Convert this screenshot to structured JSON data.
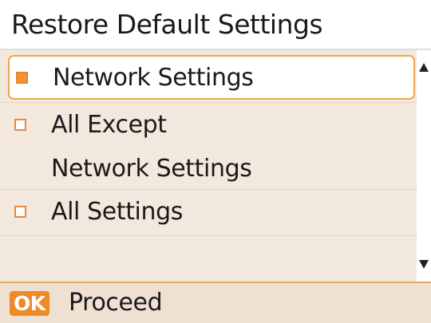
{
  "header": {
    "title": "Restore Default Settings"
  },
  "options": [
    {
      "label": "Network Settings",
      "selected": true
    },
    {
      "label": "All Except",
      "label_line2": "Network Settings",
      "selected": false
    },
    {
      "label": "All Settings",
      "selected": false
    }
  ],
  "scrollbar": {
    "up_icon": "triangle-up-icon",
    "down_icon": "triangle-down-icon"
  },
  "footer": {
    "ok_label": "OK",
    "proceed_label": "Proceed"
  },
  "colors": {
    "accent": "#f08a26",
    "list_background": "#f3e8de",
    "selection_border": "#f0a64f"
  }
}
